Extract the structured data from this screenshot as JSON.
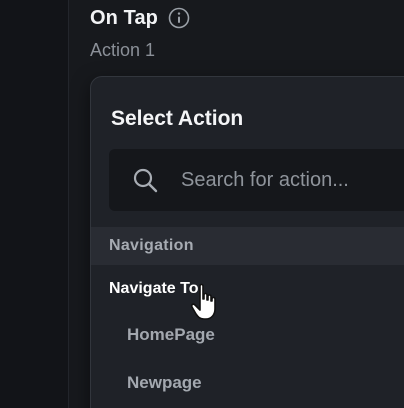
{
  "trigger": {
    "title": "On Tap",
    "info_icon": "info-icon"
  },
  "action": {
    "label": "Action 1"
  },
  "select_action": {
    "title": "Select Action",
    "search": {
      "placeholder": "Search for action...",
      "icon": "search-icon"
    },
    "sections": [
      {
        "header": "Navigation",
        "items": [
          {
            "label": "Navigate To",
            "level": 0,
            "state": "hovered"
          },
          {
            "label": "HomePage",
            "level": 1
          },
          {
            "label": "Newpage",
            "level": 1
          }
        ]
      }
    ]
  },
  "colors": {
    "background": "#15171b",
    "dropdown": "#1f2228",
    "section_header": "#292c33",
    "text_primary": "#f4f5f7",
    "text_muted": "#8b9098"
  }
}
